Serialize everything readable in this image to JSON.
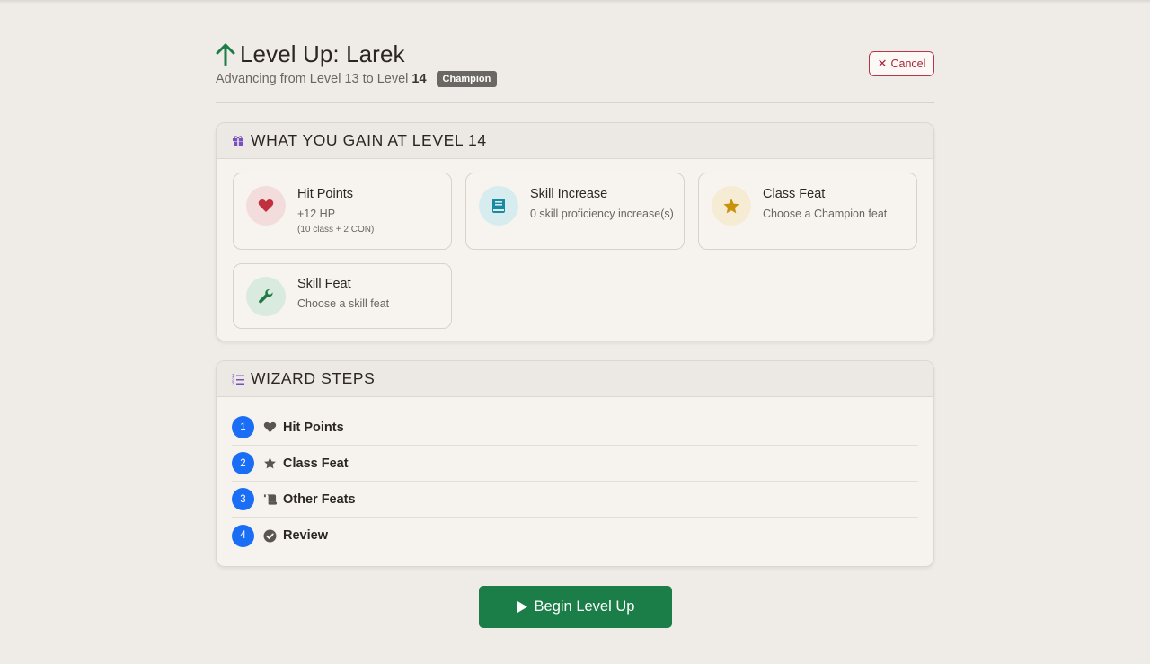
{
  "header": {
    "title": "Level Up: Larek",
    "subtitle_prefix": "Advancing from Level 13 to Level",
    "target_level": "14",
    "class_badge": "Champion",
    "cancel_label": "Cancel",
    "icons": {
      "title": "arrow-up-icon",
      "cancel": "close-icon"
    }
  },
  "gains": {
    "heading": "WHAT YOU GAIN AT LEVEL 14",
    "heading_icon": "gift-icon",
    "items": [
      {
        "title": "Hit Points",
        "desc": "+12 HP",
        "sub": "(10 class + 2 CON)",
        "icon": "heart-icon",
        "color": "#c0303f"
      },
      {
        "title": "Skill Increase",
        "desc": "0 skill proficiency increase(s)",
        "icon": "book-icon",
        "color": "#1a8aa3"
      },
      {
        "title": "Class Feat",
        "desc": "Choose a Champion feat",
        "icon": "star-icon",
        "color": "#c9920c"
      },
      {
        "title": "Skill Feat",
        "desc": "Choose a skill feat",
        "icon": "wrench-icon",
        "color": "#1f7a44"
      }
    ]
  },
  "steps": {
    "heading": "WIZARD STEPS",
    "heading_icon": "list-ol-icon",
    "items": [
      {
        "num": "1",
        "label": "Hit Points",
        "icon": "heart-icon"
      },
      {
        "num": "2",
        "label": "Class Feat",
        "icon": "star-icon"
      },
      {
        "num": "3",
        "label": "Other Feats",
        "icon": "scroll-icon"
      },
      {
        "num": "4",
        "label": "Review",
        "icon": "check-circle-icon"
      }
    ]
  },
  "actions": {
    "begin_label": "Begin Level Up",
    "begin_icon": "play-icon"
  },
  "colors": {
    "accent_green": "#1b7d47",
    "step_blue": "#1a6ef5",
    "cancel_red": "#a8283b",
    "background": "#efece7"
  }
}
